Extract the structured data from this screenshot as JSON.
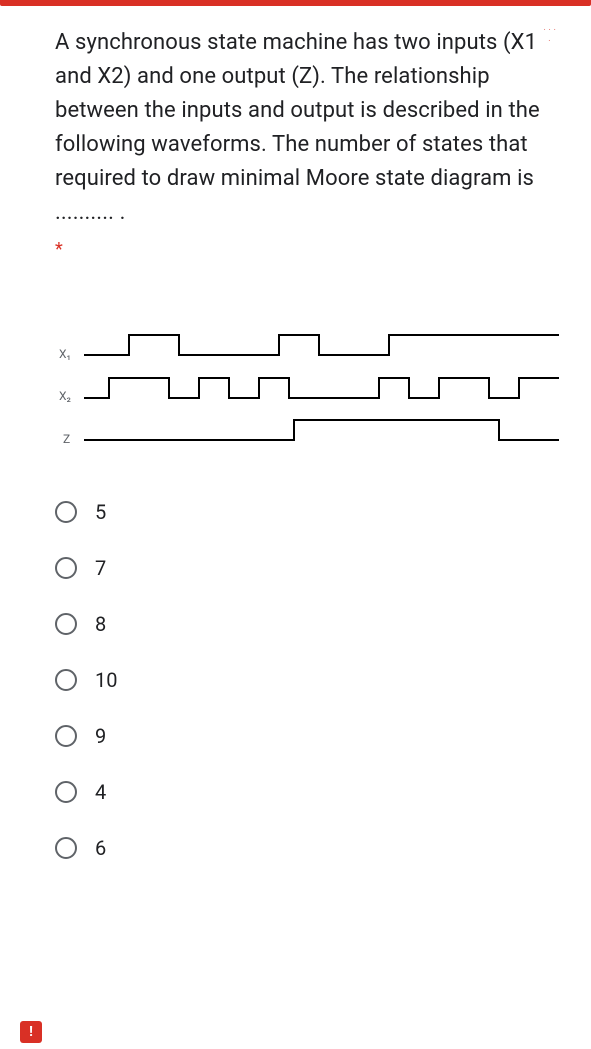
{
  "question": {
    "text": "A synchronous state machine has two inputs (X1 and X2) and one output (Z). The relationship between the inputs and output is described in the following waveforms. The number of states that required to draw minimal Moore state diagram is .......... .",
    "required_mark": "*"
  },
  "waveform": {
    "labels": {
      "x1": "X₁",
      "x2": "X₂",
      "z": "Z"
    }
  },
  "options": [
    {
      "label": "5"
    },
    {
      "label": "7"
    },
    {
      "label": "8"
    },
    {
      "label": "10"
    },
    {
      "label": "9"
    },
    {
      "label": "4"
    },
    {
      "label": "6"
    }
  ],
  "alert": "!"
}
